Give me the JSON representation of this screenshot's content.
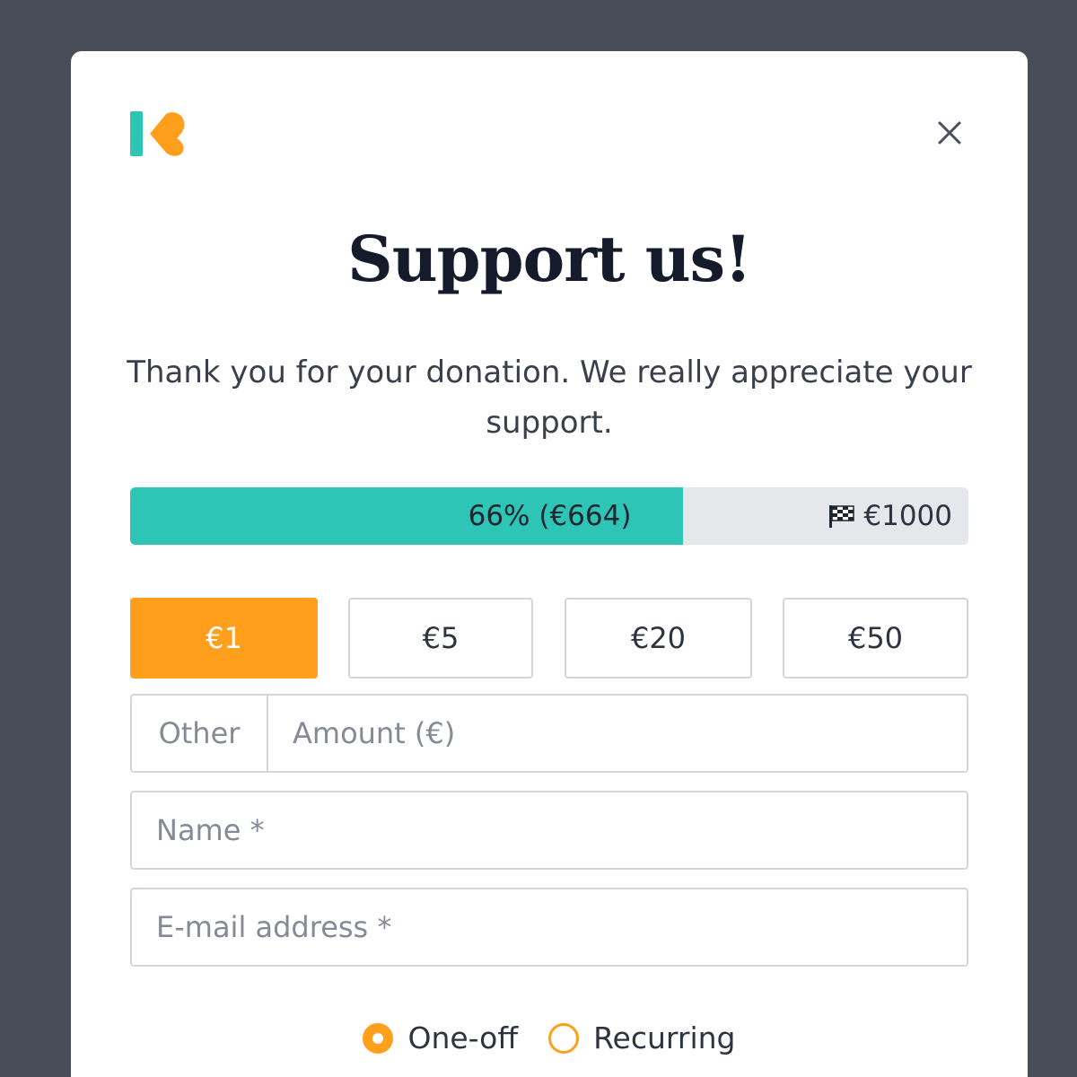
{
  "colors": {
    "backdrop": "#494d57",
    "accent": "#ff9f1c",
    "progress": "#2ec4b6",
    "logo_teal": "#2ec4b6",
    "logo_orange": "#ff9f1c"
  },
  "modal": {
    "logo_icon": "ko-fi-logo-icon",
    "close_icon": "close-icon",
    "title": "Support us!",
    "subtitle": "Thank you for your donation. We really appreciate your support."
  },
  "progress": {
    "percent": 66,
    "label": "66% (€664)",
    "goal_icon": "checkered-flag-icon",
    "goal_label": "€1000"
  },
  "amounts": [
    {
      "label": "€1",
      "selected": true
    },
    {
      "label": "€5",
      "selected": false
    },
    {
      "label": "€20",
      "selected": false
    },
    {
      "label": "€50",
      "selected": false
    }
  ],
  "form": {
    "other_prefix": "Other",
    "amount_placeholder": "Amount (€)",
    "name_placeholder": "Name *",
    "email_placeholder": "E-mail address *"
  },
  "frequency": {
    "options": [
      {
        "label": "One-off",
        "checked": true
      },
      {
        "label": "Recurring",
        "checked": false
      }
    ]
  }
}
